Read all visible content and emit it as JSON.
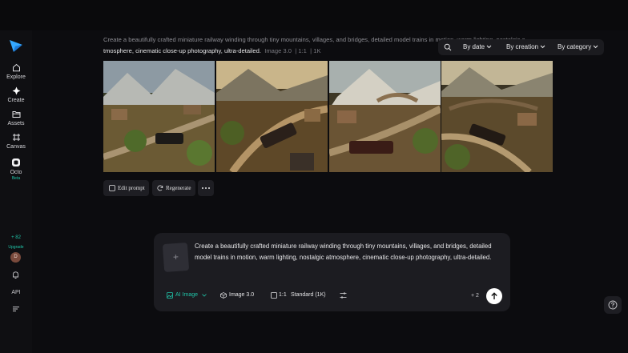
{
  "sidebar": {
    "logo_icon": "paper-plane-logo",
    "items": [
      {
        "label": "Explore",
        "icon": "home-icon"
      },
      {
        "label": "Create",
        "icon": "sparkle-icon"
      },
      {
        "label": "Assets",
        "icon": "folder-icon"
      },
      {
        "label": "Canvas",
        "icon": "canvas-icon"
      },
      {
        "label": "Octo",
        "icon": "octo-icon",
        "badge": "Beta"
      }
    ],
    "credits": {
      "count": "+ 82",
      "upgrade": "Upgrade"
    },
    "avatar": "D",
    "api": "API"
  },
  "generation": {
    "prompt_line1": "Create a beautifully crafted miniature railway winding through tiny mountains, villages, and bridges, detailed model trains in motion, warm lighting, nostalgic a",
    "prompt_line2": "tmosphere, cinematic close-up photography, ultra-detailed.",
    "model": "Image 3.0",
    "ratio": "1:1",
    "resolution": "1K",
    "images": [
      {
        "alt": "miniature railway render 1"
      },
      {
        "alt": "miniature railway render 2"
      },
      {
        "alt": "miniature railway render 3"
      },
      {
        "alt": "miniature railway render 4"
      }
    ],
    "actions": {
      "edit": "Edit prompt",
      "regenerate": "Regenerate"
    }
  },
  "filters": {
    "date": "By date",
    "creation": "By creation",
    "category": "By category"
  },
  "composer": {
    "text": "Create a beautifully crafted miniature railway winding through tiny mountains, villages, and bridges, detailed model trains in motion, warm lighting, nostalgic atmosphere, cinematic close-up photography, ultra-detailed.",
    "mode": "AI Image",
    "model": "Image 3.0",
    "ratio": "1:1",
    "quality": "Standard (1K)",
    "cost": "+ 2"
  },
  "colors": {
    "accent": "#20c4a8",
    "bg": "#0c0c0f",
    "panel": "#1c1c21"
  }
}
